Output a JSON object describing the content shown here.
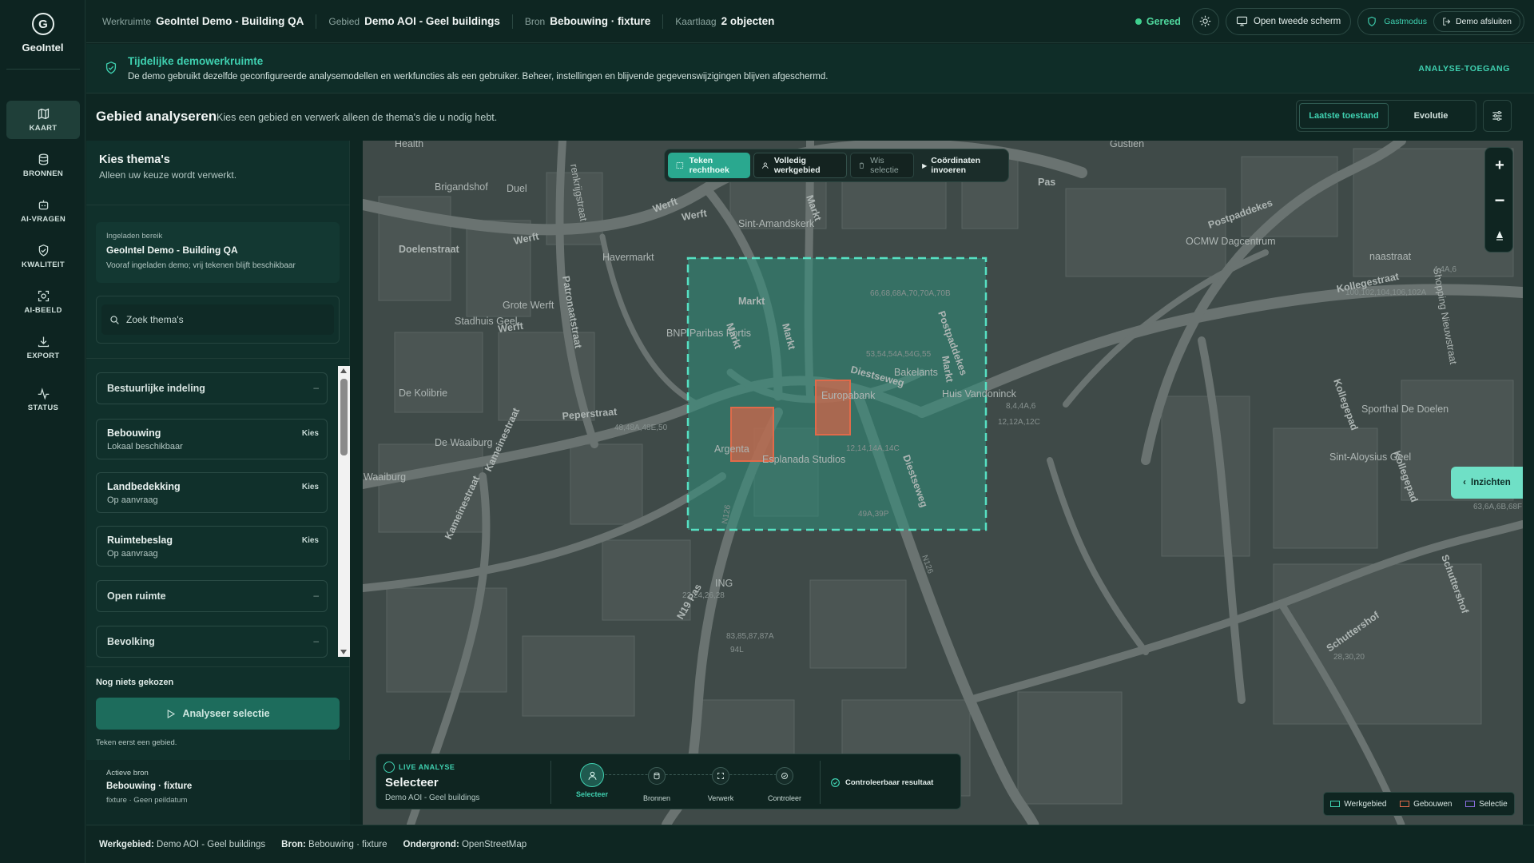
{
  "app": {
    "name": "GeoIntel"
  },
  "rail": [
    {
      "label": "KAART",
      "icon": "map-icon"
    },
    {
      "label": "BRONNEN",
      "icon": "database-icon"
    },
    {
      "label": "AI-VRAGEN",
      "icon": "robot-icon"
    },
    {
      "label": "KWALITEIT",
      "icon": "shield-check-icon"
    },
    {
      "label": "AI-BEELD",
      "icon": "scan-icon"
    },
    {
      "label": "EXPORT",
      "icon": "download-icon"
    },
    {
      "label": "STATUS",
      "icon": "activity-icon"
    }
  ],
  "topbar": {
    "crumbs": [
      {
        "key": "Werkruimte",
        "value": "GeoIntel Demo - Building QA"
      },
      {
        "key": "Gebied",
        "value": "Demo AOI - Geel buildings"
      },
      {
        "key": "Bron",
        "value": "Bebouwing · fixture"
      },
      {
        "key": "Kaartlaag",
        "value": "2 objecten"
      }
    ],
    "status": "Gereed",
    "second_screen": "Open tweede scherm",
    "guest_mode": "Gastmodus",
    "end_demo": "Demo afsluiten"
  },
  "banner": {
    "title": "Tijdelijke demowerkruimte",
    "text": "De demo gebruikt dezelfde geconfigureerde analysemodellen en werkfuncties als een gebruiker. Beheer, instellingen en blijvende gegevenswijzigingen blijven afgeschermd.",
    "access_link": "ANALYSE-TOEGANG"
  },
  "header": {
    "title": "Gebied analyseren",
    "subtitle": "Kies een gebied en verwerk alleen de thema's die u nodig hebt.",
    "tabs": [
      "Laatste toestand",
      "Evolutie"
    ]
  },
  "panel": {
    "title": "Kies thema's",
    "subtitle": "Alleen uw keuze wordt verwerkt.",
    "loaded": {
      "label": "Ingeladen bereik",
      "name": "GeoIntel Demo - Building QA",
      "desc": "Vooraf ingeladen demo; vrij tekenen blijft beschikbaar"
    },
    "search_placeholder": "Zoek thema's",
    "themes": [
      {
        "title": "Bestuurlijke indeling",
        "sub": "",
        "action": "–"
      },
      {
        "title": "Bebouwing",
        "sub": "Lokaal beschikbaar",
        "action": "Kies"
      },
      {
        "title": "Landbedekking",
        "sub": "Op aanvraag",
        "action": "Kies"
      },
      {
        "title": "Ruimtebeslag",
        "sub": "Op aanvraag",
        "action": "Kies"
      },
      {
        "title": "Open ruimte",
        "sub": "",
        "action": "–"
      },
      {
        "title": "Bevolking",
        "sub": "",
        "action": "–"
      }
    ],
    "selection_status": "Nog niets gekozen",
    "analyse_button": "Analyseer selectie",
    "hint": "Teken eerst een gebied.",
    "active_source": {
      "label": "Actieve bron",
      "name": "Bebouwing · fixture",
      "meta": "fixture · Geen peildatum"
    }
  },
  "map": {
    "toolbar": {
      "draw_rect": "Teken rechthoek",
      "full_area": "Volledig werkgebied",
      "clear": "Wis selectie",
      "coords": "Coördinaten invoeren"
    },
    "insights": "Inzichten",
    "street_labels": [
      "Brigandshof",
      "Werft",
      "Werft",
      "Werft",
      "Werft",
      "Markt",
      "Markt",
      "Markt",
      "Markt",
      "Markt",
      "Patronaatstraat",
      "Stadhuis Geel",
      "Grote Werft",
      "Havermarkt",
      "Sint-Amandskerk",
      "OCMW Dagcentrum",
      "Postpaddekes",
      "Postpaddekes",
      "Kollegestraat",
      "Kollegepad",
      "Kollegepad",
      "Diestseweg",
      "Diestseweg",
      "Europabank",
      "Bakelants",
      "Huis Vandoninck",
      "BNP Paribas Fortis",
      "De Kolibrie",
      "Peperstraat",
      "Kameinestraat",
      "Kameinestraat",
      "De Waaiburg",
      "Waaiburg",
      "Argenta",
      "Esplanada Studios",
      "ING",
      "Sporthal De Doelen",
      "Sint-Aloysius Geel",
      "Schuttershof",
      "Schuttershof",
      "N126",
      "N126",
      "N19 Pas",
      "Pas",
      "Shopping Nieuwstraat",
      "Doelenstraat",
      "Duel",
      "Gustien",
      "Health",
      "renkrijgstraat",
      "naastraat",
      "100,102,104,106,102A",
      "66,68,68A,70,70A,70B",
      "53,54,54A,54G,55",
      "8,4,4A,6",
      "12,12A,12C",
      "12,14,14A,14C",
      "22,24,26,28",
      "83,85,87,87A",
      "48,48A,48E,50",
      "28,30,20",
      "63,6A,6B,68F",
      "49A,39P",
      "4,4A,6",
      "94L"
    ],
    "legend": [
      "Werkgebied",
      "Gebouwen",
      "Selectie"
    ],
    "legend_colors": [
      "#3fd0b0",
      "#e06a4a",
      "#8a6ee0"
    ],
    "analysis": {
      "label": "LIVE ANALYSE",
      "title": "Selecteer",
      "subtitle": "Demo AOI - Geel buildings",
      "steps": [
        "Selecteer",
        "Bronnen",
        "Verwerk",
        "Controleer"
      ],
      "result": "Controleerbaar resultaat"
    }
  },
  "footer": {
    "items": [
      {
        "key": "Werkgebied:",
        "value": "Demo AOI - Geel buildings"
      },
      {
        "key": "Bron:",
        "value": "Bebouwing · fixture"
      },
      {
        "key": "Ondergrond:",
        "value": "OpenStreetMap"
      }
    ]
  },
  "colors": {
    "accent": "#2fb59a",
    "accent_dark": "#1d7f6c",
    "bg": "#0e2622",
    "building": "#e06a4a"
  }
}
